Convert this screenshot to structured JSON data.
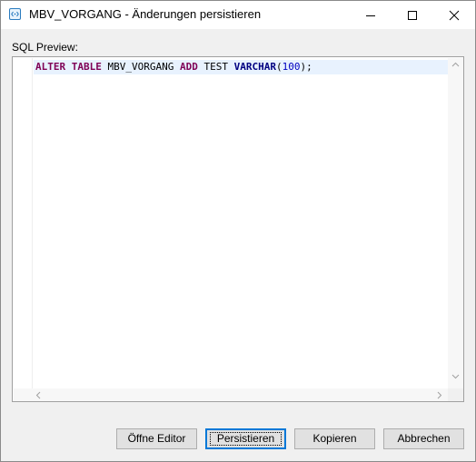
{
  "window": {
    "title": "MBV_VORGANG - Änderungen persistieren",
    "app_icon": "sql-file-icon",
    "controls": [
      "minimize-icon",
      "maximize-icon",
      "close-icon"
    ]
  },
  "preview": {
    "label": "SQL Preview:",
    "line": {
      "kw1": "ALTER",
      "sp1": " ",
      "kw2": "TABLE",
      "ident": " MBV_VORGANG ",
      "kw3": "ADD",
      "col": " TEST ",
      "type": "VARCHAR",
      "open": "(",
      "num": "100",
      "close": ");"
    }
  },
  "buttons": {
    "open_editor": "Öffne Editor",
    "persist": "Persistieren",
    "copy": "Kopieren",
    "cancel": "Abbrechen"
  },
  "colors": {
    "keyword": "#7f0055",
    "type": "#000080",
    "number": "#0000c0",
    "current_line": "#e8f2fe",
    "default_button_border": "#0078d7"
  }
}
